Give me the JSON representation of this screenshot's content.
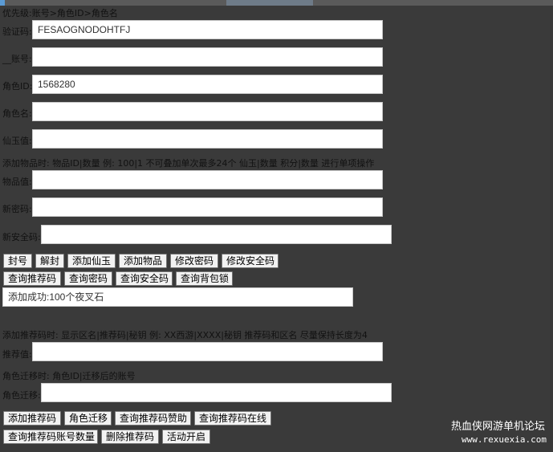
{
  "header_note": "优先级:账号>角色ID>角色名",
  "fields": {
    "captcha": {
      "label": "验证码:",
      "value": "FESAOGNODOHTFJ"
    },
    "account": {
      "label": "__账号:",
      "value": ""
    },
    "role_id": {
      "label": "角色ID:",
      "value": "1568280"
    },
    "role_name": {
      "label": "角色名:",
      "value": ""
    },
    "jade": {
      "label": "仙玉值:",
      "value": ""
    }
  },
  "item_note": "添加物品时: 物品ID|数量 例: 100|1 不可叠加单次最多24个 仙玉|数量 积分|数量 进行单项操作",
  "fields2": {
    "item": {
      "label": "物品值:",
      "value": ""
    },
    "new_password": {
      "label": "新密码:",
      "value": ""
    },
    "new_security": {
      "label": "新安全码:",
      "value": ""
    }
  },
  "buttons_row1": [
    "封号",
    "解封",
    "添加仙玉",
    "添加物品",
    "修改密码",
    "修改安全码"
  ],
  "buttons_row2": [
    "查询推荐码",
    "查询密码",
    "查询安全码",
    "查询背包锁"
  ],
  "result": "添加成功:100个夜叉石",
  "recommend_note": "添加推荐码时: 显示区名|推荐码|秘钥 例: XX西游|XXXX|秘钥 推荐码和区名 尽量保持长度为4",
  "recommend": {
    "label": "推荐值:",
    "value": ""
  },
  "migrate_note": "角色迁移时: 角色ID|迁移后的账号",
  "migrate": {
    "label": "角色迁移:",
    "value": ""
  },
  "buttons_row3": [
    "添加推荐码",
    "角色迁移",
    "查询推荐码赞助",
    "查询推荐码在线"
  ],
  "buttons_row4": [
    "查询推荐码账号数量",
    "删除推荐码",
    "活动开启"
  ],
  "watermark": {
    "line1": "热血侠网游单机论坛",
    "line2": "www.rexuexia.com"
  }
}
